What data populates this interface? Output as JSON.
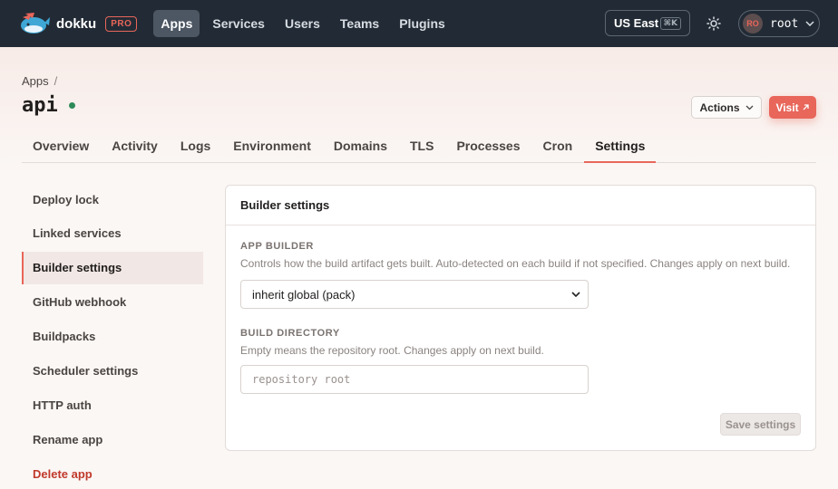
{
  "nav": {
    "brand": "dokku",
    "badge": "PRO",
    "items": [
      {
        "label": "Apps",
        "active": true
      },
      {
        "label": "Services",
        "active": false
      },
      {
        "label": "Users",
        "active": false
      },
      {
        "label": "Teams",
        "active": false
      },
      {
        "label": "Plugins",
        "active": false
      }
    ],
    "region": "US East",
    "region_shortcut": "⌘K",
    "theme_icon": "sun-icon",
    "user": {
      "initials": "RO",
      "name": "root"
    }
  },
  "breadcrumb": {
    "root": "Apps",
    "separator": "/"
  },
  "app": {
    "name": "api",
    "status_color": "#2e8b57"
  },
  "header_buttons": {
    "actions": "Actions",
    "visit": "Visit"
  },
  "tabs": [
    {
      "label": "Overview",
      "active": false
    },
    {
      "label": "Activity",
      "active": false
    },
    {
      "label": "Logs",
      "active": false
    },
    {
      "label": "Environment",
      "active": false
    },
    {
      "label": "Domains",
      "active": false
    },
    {
      "label": "TLS",
      "active": false
    },
    {
      "label": "Processes",
      "active": false
    },
    {
      "label": "Cron",
      "active": false
    },
    {
      "label": "Settings",
      "active": true
    }
  ],
  "sidebar": {
    "items": [
      {
        "label": "Deploy lock"
      },
      {
        "label": "Linked services"
      },
      {
        "label": "Builder settings"
      },
      {
        "label": "GitHub webhook"
      },
      {
        "label": "Buildpacks"
      },
      {
        "label": "Scheduler settings"
      },
      {
        "label": "HTTP auth"
      },
      {
        "label": "Rename app"
      },
      {
        "label": "Delete app"
      }
    ]
  },
  "card": {
    "title": "Builder settings",
    "app_builder": {
      "label": "APP BUILDER",
      "help": "Controls how the build artifact gets built. Auto-detected on each build if not specified. Changes apply on next build.",
      "value": "inherit global (pack)"
    },
    "build_directory": {
      "label": "BUILD DIRECTORY",
      "help": "Empty means the repository root. Changes apply on next build.",
      "placeholder": "repository root",
      "value": ""
    },
    "save_label": "Save settings"
  },
  "colors": {
    "accent": "#e8665a",
    "nav_bg": "#222b35",
    "danger": "#c0392b",
    "status_ok": "#2e8b57"
  }
}
